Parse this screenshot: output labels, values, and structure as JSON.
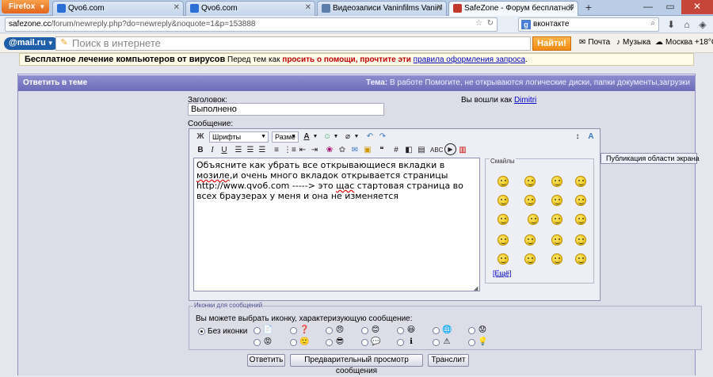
{
  "browser": {
    "app_button": "Firefox",
    "tabs": [
      {
        "title": "Qvo6.com",
        "active": false,
        "favicon_color": "#2a6fd6"
      },
      {
        "title": "Qvo6.com",
        "active": false,
        "favicon_color": "#2a6fd6"
      },
      {
        "title": "Видеозаписи Vaninfilms Vaninfilms | ...",
        "active": false,
        "favicon_color": "#5b7fa8"
      },
      {
        "title": "SafeZone - Форум бесплатной пом...",
        "active": true,
        "favicon_color": "#c0392b"
      }
    ],
    "url_domain": "safezone.cc",
    "url_path": "/forum/newreply.php?do=newreply&noquote=1&p=153888",
    "search_value": "вконтакте"
  },
  "mailru_bar": {
    "logo": "@mail.ru",
    "search_placeholder": "Поиск в интернете",
    "find_button": "Найти!",
    "mail_label": "Почта",
    "music_label": "Музыка",
    "weather_label": "Москва +18°C"
  },
  "notice": {
    "title": "Бесплатное лечение компьютеров от вирусов",
    "before": "Перед тем как",
    "warning": "просить о помощи, прочтите эти",
    "link": "правила оформления запроса",
    "tail": "."
  },
  "reply": {
    "header": "Ответить в теме",
    "topic_label": "Тема:",
    "topic_text": "В работе Помогите, не открываются логические диски, папки документы,загрузки",
    "subject_label": "Заголовок:",
    "subject_value": "Выполнено",
    "message_label": "Сообщение:",
    "logged_in_text": "Вы вошли как",
    "username": "Dimitri"
  },
  "editor": {
    "font_select": "Шрифты",
    "size_select": "Разме",
    "spell_label": "ABC",
    "message_lines": [
      "Объясните как убрать все открывающиеся вкладки в ",
      "мозиле",
      ",и очень много вкладок открывается страницы http://www.qvo6.com -----> это ",
      "щас",
      " стартовая страница во всех браузерах у меня и она не изменяется"
    ],
    "smilies_legend": "Смайлы",
    "more_smilies": "[Ещё]",
    "tooltip": "Публикация области экрана"
  },
  "post_icons": {
    "legend": "Иконки для сообщений",
    "hint": "Вы можете выбрать иконку, характеризующую сообщение:",
    "none_label": "Без иконки",
    "icons": [
      "📄",
      "❓",
      "😠",
      "😊",
      "😃",
      "🌐",
      "😟",
      "😡",
      "🙂",
      "😎",
      "💬",
      "ℹ",
      "⚠",
      "💡",
      "➡",
      "👎"
    ]
  },
  "buttons": {
    "submit": "Ответить",
    "preview": "Предварительный просмотр сообщения",
    "translit": "Транслит"
  }
}
